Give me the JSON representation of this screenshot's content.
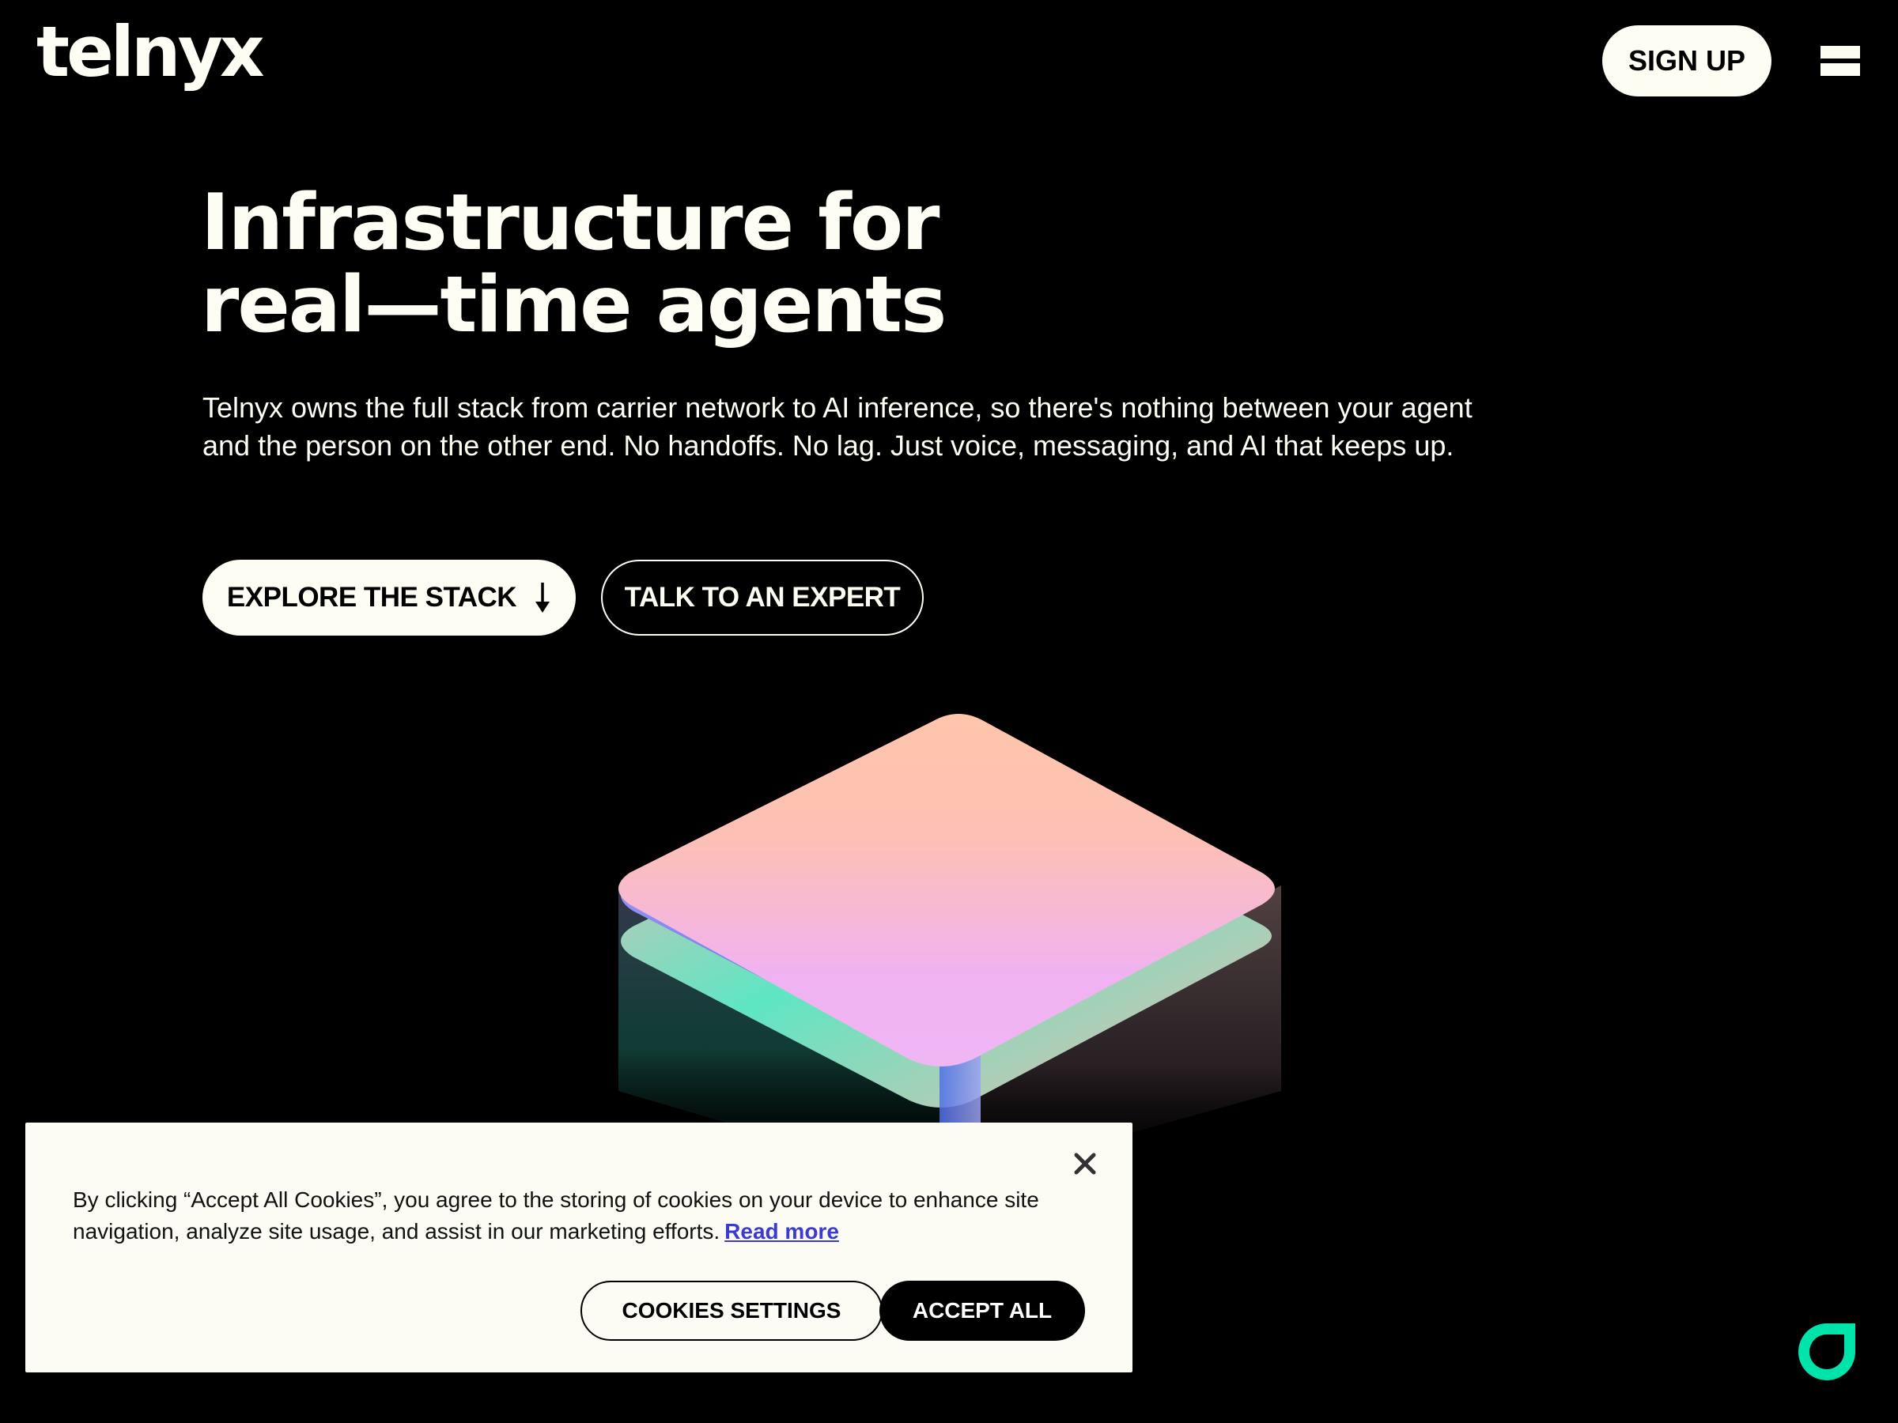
{
  "brand": {
    "logo_text": "telnyx",
    "accent_color": "#00e3aa",
    "background_color": "#000000",
    "text_color": "#fefdf3"
  },
  "header": {
    "signup_label": "SIGN UP",
    "menu_icon": "hamburger-menu-icon"
  },
  "hero": {
    "title_line1": "Infrastructure for",
    "title_line2": "real—time agents",
    "description": "Telnyx owns the full stack from carrier network to AI inference, so there's nothing between your agent and the person on the other end. No handoffs. No lag. Just voice, messaging, and AI that keeps up.",
    "explore_button": {
      "label": "EXPLORE THE STACK",
      "icon": "arrow-down-icon"
    },
    "expert_button_label": "TALK TO AN EXPERT"
  },
  "cookie_banner": {
    "text": "By clicking “Accept All Cookies”, you agree to the storing of cookies on your device to enhance site navigation, analyze site usage, and assist in our marketing efforts.",
    "read_more_label": "Read more",
    "settings_label": "COOKIES SETTINGS",
    "accept_label": "ACCEPT ALL",
    "close_icon": "close-icon"
  },
  "chat": {
    "icon": "chat-bubble-icon"
  }
}
